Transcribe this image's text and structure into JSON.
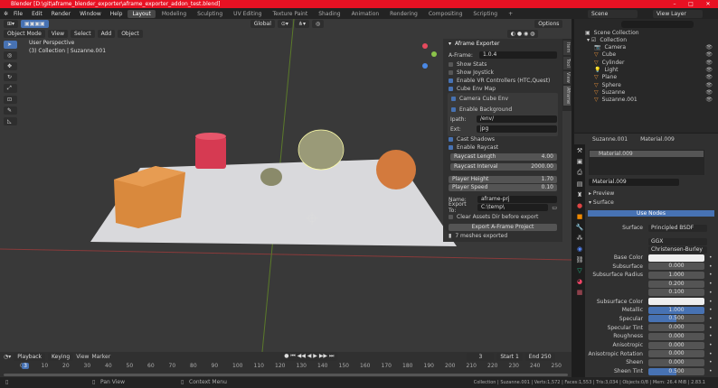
{
  "title": "Blender [D:\\git\\aframe_blender_exporter\\aframe_exporter_addon_test.blend]",
  "menu": [
    "File",
    "Edit",
    "Render",
    "Window",
    "Help"
  ],
  "workspaces": [
    "Layout",
    "Modeling",
    "Sculpting",
    "UV Editing",
    "Texture Paint",
    "Shading",
    "Animation",
    "Rendering",
    "Compositing",
    "Scripting"
  ],
  "scene": "Scene",
  "view_layer": "View Layer",
  "viewport": {
    "mode": "Object Mode",
    "menus": [
      "View",
      "Select",
      "Add",
      "Object"
    ],
    "orientation": "Global",
    "options": "Options",
    "perspective": "User Perspective",
    "collection_info": "(3) Collection | Suzanne.001"
  },
  "npanel": {
    "title": "Aframe Exporter",
    "aframe_label": "A-Frame:",
    "aframe_version": "1.0.4",
    "show_stats": "Show Stats",
    "show_joystick": "Show Joystick",
    "vr_controllers": "Enable VR Controllers (HTC,Quest)",
    "cube_env": "Cube Env Map",
    "camera_cube_env": "Camera Cube Env",
    "enable_bg": "Enable Background",
    "ipath_label": "Ipath:",
    "ipath": "/env/",
    "ext_label": "Ext:",
    "ext": "jpg",
    "cast_shadows": "Cast Shadows",
    "enable_raycast": "Enable Raycast",
    "raycast_length_label": "Raycast Length",
    "raycast_length": "4.00",
    "raycast_interval_label": "Raycast Interval",
    "raycast_interval": "2000.00",
    "player_height_label": "Player Height",
    "player_height": "1.70",
    "player_speed_label": "Player Speed",
    "player_speed": "0.10",
    "name_label": "Name:",
    "name": "aframe-prj",
    "export_label": "Export To:",
    "export_to": "C:\\temp\\",
    "clear_assets": "Clear Assets Dir before export",
    "export_button": "Export A-Frame Project",
    "status": "7 meshes exported",
    "tabs": [
      "Item",
      "Tool",
      "View",
      "Aframe"
    ]
  },
  "outliner": {
    "root": "Scene Collection",
    "collection": "Collection",
    "items": [
      "Camera",
      "Cube",
      "Cylinder",
      "Light",
      "Plane",
      "Sphere",
      "Suzanne",
      "Suzanne.001"
    ]
  },
  "properties": {
    "object": "Suzanne.001",
    "material_tab": "Material.009",
    "slot": "Material.009",
    "material": "Material.009",
    "preview": "Preview",
    "surface_section": "Surface",
    "use_nodes": "Use Nodes",
    "surface_label": "Surface",
    "surface_value": "Principled BSDF",
    "distribution": "GGX",
    "subsurface_method": "Christensen-Burley",
    "rows": [
      {
        "label": "Base Color",
        "value": "",
        "kind": "color"
      },
      {
        "label": "Subsurface",
        "value": "0.000",
        "fill": 0
      },
      {
        "label": "Subsurface Radius",
        "value": "1.000",
        "fill": 0
      },
      {
        "label": "",
        "value": "0.200",
        "fill": 0
      },
      {
        "label": "",
        "value": "0.100",
        "fill": 0
      },
      {
        "label": "Subsurface Color",
        "value": "",
        "kind": "color"
      },
      {
        "label": "Metallic",
        "value": "1.000",
        "fill": 1
      },
      {
        "label": "Specular",
        "value": "0.500",
        "fill": 0.5
      },
      {
        "label": "Specular Tint",
        "value": "0.000",
        "fill": 0
      },
      {
        "label": "Roughness",
        "value": "0.000",
        "fill": 0
      },
      {
        "label": "Anisotropic",
        "value": "0.000",
        "fill": 0
      },
      {
        "label": "Anisotropic Rotation",
        "value": "0.000",
        "fill": 0
      },
      {
        "label": "Sheen",
        "value": "0.000",
        "fill": 0
      },
      {
        "label": "Sheen Tint",
        "value": "0.500",
        "fill": 0.5
      }
    ]
  },
  "timeline": {
    "menus": [
      "Playback",
      "Keying",
      "View",
      "Marker"
    ],
    "current_frame": "3",
    "start_label": "Start",
    "start": "1",
    "end_label": "End",
    "end": "250",
    "ticks": [
      "0",
      "10",
      "20",
      "30",
      "40",
      "50",
      "60",
      "70",
      "80",
      "90",
      "100",
      "110",
      "120",
      "130",
      "140",
      "150",
      "160",
      "170",
      "180",
      "190",
      "200",
      "210",
      "220",
      "230",
      "240",
      "250"
    ]
  },
  "statusbar": {
    "pan": "Pan View",
    "context": "Context Menu",
    "stats": "Collection | Suzanne.001 | Verts:1,572 | Faces:1,553 | Tris:3,034 | Objects:0/8 | Mem: 26.4 MiB | 2.83.1"
  },
  "colors": {
    "accent": "#4772b3",
    "titlebar": "#e81123"
  }
}
